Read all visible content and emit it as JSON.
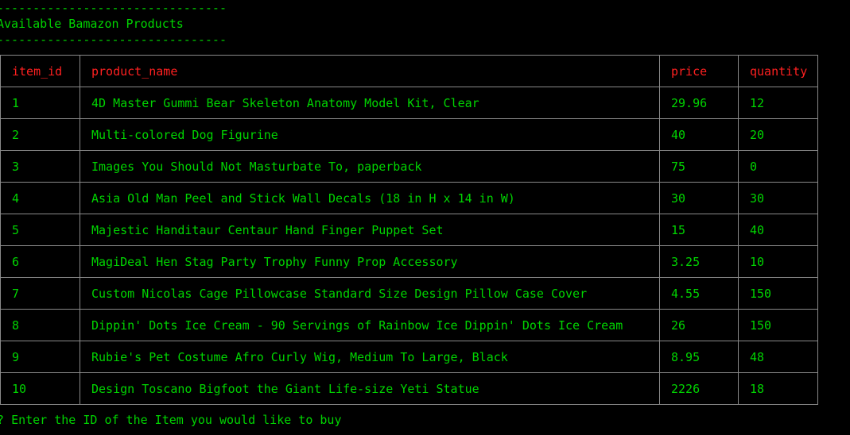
{
  "colors": {
    "background": "#000000",
    "text": "#00d400",
    "header_text": "#ff2020",
    "border": "#8a8a8a"
  },
  "banner": {
    "rule": "--------------------------------",
    "heading": "Available Bamazon Products"
  },
  "table": {
    "headers": {
      "item_id": "item_id",
      "product_name": "product_name",
      "price": "price",
      "quantity": "quantity"
    },
    "rows": [
      {
        "item_id": "1",
        "product_name": "4D Master Gummi Bear Skeleton Anatomy Model Kit, Clear",
        "price": "29.96",
        "quantity": "12"
      },
      {
        "item_id": "2",
        "product_name": "Multi-colored Dog Figurine",
        "price": "40",
        "quantity": "20"
      },
      {
        "item_id": "3",
        "product_name": "Images You Should Not Masturbate To, paperback",
        "price": "75",
        "quantity": "0"
      },
      {
        "item_id": "4",
        "product_name": "Asia Old Man Peel and Stick Wall Decals (18 in H x 14 in W)",
        "price": "30",
        "quantity": "30"
      },
      {
        "item_id": "5",
        "product_name": "Majestic Handitaur Centaur Hand Finger Puppet Set",
        "price": "15",
        "quantity": "40"
      },
      {
        "item_id": "6",
        "product_name": "MagiDeal Hen Stag Party Trophy Funny Prop Accessory",
        "price": "3.25",
        "quantity": "10"
      },
      {
        "item_id": "7",
        "product_name": "Custom Nicolas Cage Pillowcase Standard Size Design Pillow Case Cover",
        "price": "4.55",
        "quantity": "150"
      },
      {
        "item_id": "8",
        "product_name": "Dippin' Dots Ice Cream - 90 Servings of Rainbow Ice Dippin' Dots Ice Cream",
        "price": "26",
        "quantity": "150"
      },
      {
        "item_id": "9",
        "product_name": "Rubie's Pet Costume Afro Curly Wig, Medium To Large, Black",
        "price": "8.95",
        "quantity": "48"
      },
      {
        "item_id": "10",
        "product_name": "Design Toscano Bigfoot the Giant Life-size Yeti Statue",
        "price": "2226",
        "quantity": "18"
      }
    ]
  },
  "prompt": {
    "marker": "?",
    "question": "Enter the ID of the Item you would like to buy"
  }
}
